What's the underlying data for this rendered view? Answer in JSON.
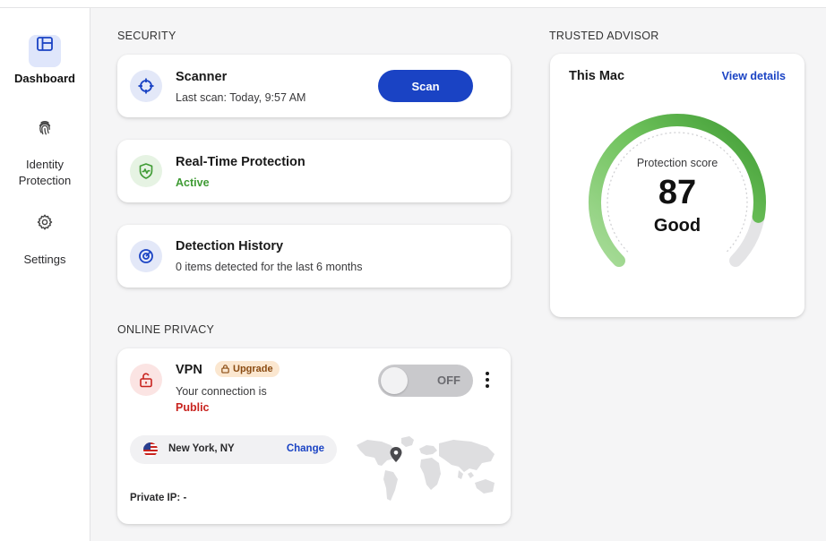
{
  "sidebar": {
    "items": [
      {
        "label": "Dashboard",
        "icon": "dashboard-icon",
        "active": true
      },
      {
        "label": "Identity Protection",
        "icon": "fingerprint-icon",
        "active": false
      },
      {
        "label": "Settings",
        "icon": "gear-icon",
        "active": false
      }
    ]
  },
  "security": {
    "title": "SECURITY",
    "scanner": {
      "title": "Scanner",
      "subtitle": "Last scan: Today, 9:57 AM",
      "button": "Scan"
    },
    "realtime": {
      "title": "Real-Time Protection",
      "status": "Active"
    },
    "history": {
      "title": "Detection History",
      "subtitle": "0 items detected for the last 6 months"
    }
  },
  "privacy": {
    "title": "ONLINE PRIVACY",
    "vpn": {
      "title": "VPN",
      "badge": "Upgrade",
      "status_prefix": "Your connection is",
      "status": "Public",
      "toggle": "OFF",
      "location": "New York, NY",
      "change": "Change",
      "private_ip": "Private IP: -"
    }
  },
  "advisor": {
    "title": "TRUSTED ADVISOR",
    "device": "This Mac",
    "link": "View details",
    "score_label": "Protection score",
    "score": "87",
    "rating": "Good",
    "score_fraction": 0.87
  },
  "colors": {
    "accent": "#1a43c4",
    "active_green": "#3f9b34",
    "public_red": "#c8231e",
    "gauge_green": "#4caf3e"
  }
}
